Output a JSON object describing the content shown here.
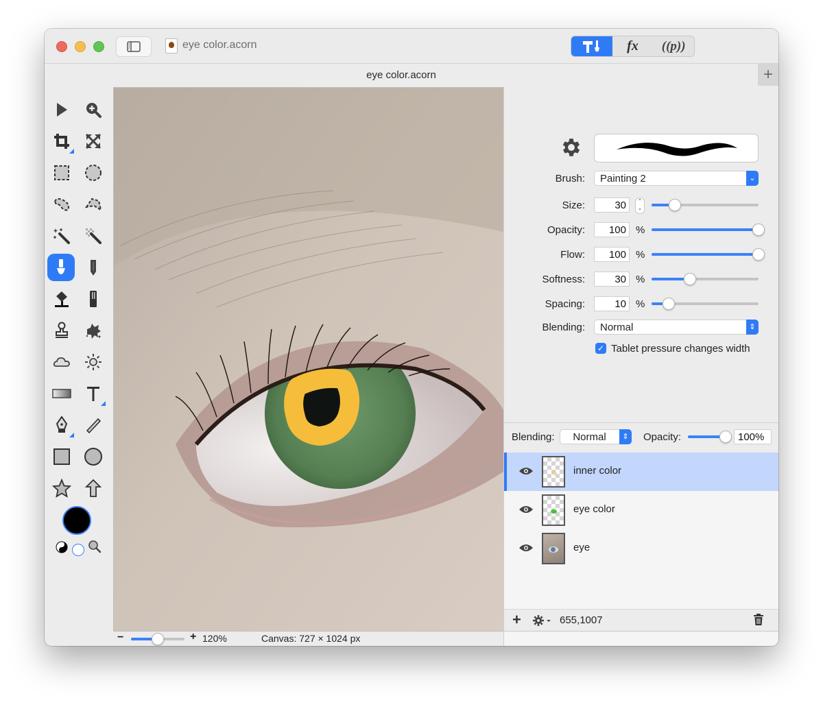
{
  "window": {
    "title": "eye color.acorn",
    "document_tab_title": "eye color.acorn",
    "toolbar_segments": [
      {
        "name": "tools",
        "icon": "hammer-brush-icon",
        "active": true
      },
      {
        "name": "filters",
        "label": "fx",
        "active": false
      },
      {
        "name": "plugins",
        "label": "((p))",
        "active": false
      }
    ],
    "new_tab_label": "+"
  },
  "tools": [
    {
      "name": "select",
      "icon": "arrow-cursor-icon"
    },
    {
      "name": "zoom",
      "icon": "zoom-in-icon"
    },
    {
      "name": "crop",
      "icon": "crop-icon",
      "has_submenu": true
    },
    {
      "name": "transform",
      "icon": "expand-arrows-icon"
    },
    {
      "name": "rect-select",
      "icon": "rect-marquee-icon"
    },
    {
      "name": "ellipse-select",
      "icon": "ellipse-marquee-icon"
    },
    {
      "name": "lasso",
      "icon": "lasso-icon"
    },
    {
      "name": "polygon-lasso",
      "icon": "polygon-lasso-icon"
    },
    {
      "name": "magic-wand",
      "icon": "magic-wand-icon"
    },
    {
      "name": "instant-alpha",
      "icon": "instant-alpha-icon"
    },
    {
      "name": "brush",
      "icon": "brush-icon",
      "active": true
    },
    {
      "name": "pencil",
      "icon": "pencil-icon"
    },
    {
      "name": "paint-bucket",
      "icon": "paint-bucket-icon"
    },
    {
      "name": "eraser",
      "icon": "eraser-icon"
    },
    {
      "name": "clone-stamp",
      "icon": "stamp-icon"
    },
    {
      "name": "smudge",
      "icon": "splatter-icon"
    },
    {
      "name": "burn",
      "icon": "cloud-icon"
    },
    {
      "name": "dodge",
      "icon": "sun-icon"
    },
    {
      "name": "gradient",
      "icon": "gradient-icon"
    },
    {
      "name": "text",
      "icon": "text-icon",
      "has_submenu": true
    },
    {
      "name": "pen",
      "icon": "pen-nib-icon",
      "has_submenu": true
    },
    {
      "name": "line",
      "icon": "line-icon"
    },
    {
      "name": "rectangle",
      "icon": "rectangle-shape-icon"
    },
    {
      "name": "oval",
      "icon": "circle-shape-icon"
    },
    {
      "name": "star",
      "icon": "star-icon"
    },
    {
      "name": "arrow",
      "icon": "arrow-up-icon"
    }
  ],
  "colors": {
    "foreground": "#000000",
    "background": "#ffffff",
    "accent": "#2f7bf6",
    "stroke_color": "#f6bd3a",
    "iris_color": "#5b8a58"
  },
  "brush_settings": {
    "brush_label": "Brush:",
    "brush_value": "Painting 2",
    "rows": [
      {
        "label": "Size:",
        "value": "30",
        "unit": "",
        "stepper": true,
        "fraction": 0.16
      },
      {
        "label": "Opacity:",
        "value": "100",
        "unit": "%",
        "fraction": 1.0
      },
      {
        "label": "Flow:",
        "value": "100",
        "unit": "%",
        "fraction": 1.0
      },
      {
        "label": "Softness:",
        "value": "30",
        "unit": "%",
        "fraction": 0.3
      },
      {
        "label": "Spacing:",
        "value": "10",
        "unit": "%",
        "fraction": 0.1
      }
    ],
    "blending_label": "Blending:",
    "blending_value": "Normal",
    "tablet_pressure_label": "Tablet pressure changes width",
    "tablet_pressure_checked": true
  },
  "layers_panel": {
    "blending_label": "Blending:",
    "blending_value": "Normal",
    "opacity_label": "Opacity:",
    "opacity_value": "100%",
    "opacity_fraction": 1.0,
    "layers": [
      {
        "name": "inner color",
        "visible": true,
        "selected": true,
        "thumb": "transparent-yellow-dot"
      },
      {
        "name": "eye color",
        "visible": true,
        "selected": false,
        "thumb": "transparent-green-blob"
      },
      {
        "name": "eye",
        "visible": true,
        "selected": false,
        "thumb": "photo"
      }
    ],
    "coordinates": "655,1007"
  },
  "status": {
    "zoom_percent": "120%",
    "zoom_fraction": 0.5,
    "canvas_info": "Canvas: 727 × 1024 px",
    "minus_label": "−",
    "plus_label": "+"
  }
}
